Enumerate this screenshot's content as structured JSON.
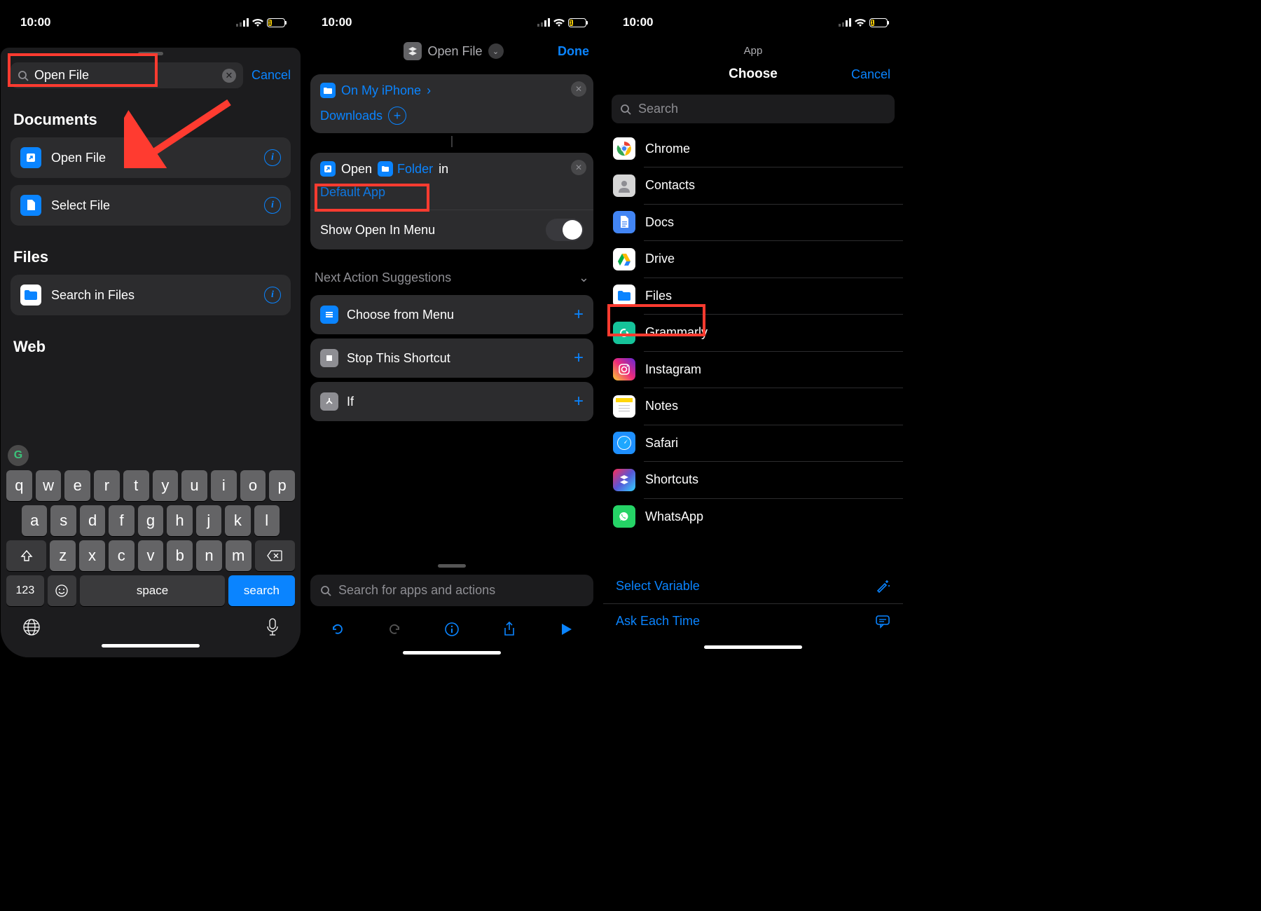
{
  "status": {
    "time": "10:00",
    "battery": "19"
  },
  "screen1": {
    "search_value": "Open File",
    "cancel": "Cancel",
    "sections": {
      "documents": "Documents",
      "files": "Files",
      "web": "Web"
    },
    "actions": {
      "open_file": "Open File",
      "select_file": "Select File",
      "search_in_files": "Search in Files"
    },
    "keyboard": {
      "row1": [
        "q",
        "w",
        "e",
        "r",
        "t",
        "y",
        "u",
        "i",
        "o",
        "p"
      ],
      "row2": [
        "a",
        "s",
        "d",
        "f",
        "g",
        "h",
        "j",
        "k",
        "l"
      ],
      "row3": [
        "z",
        "x",
        "c",
        "v",
        "b",
        "n",
        "m"
      ],
      "num": "123",
      "space": "space",
      "search": "search"
    }
  },
  "screen2": {
    "title": "Open File",
    "done": "Done",
    "path_root": "On My iPhone",
    "path_sub": "Downloads",
    "open_label": "Open",
    "folder_label": "Folder",
    "in_label": "in",
    "default_app": "Default App",
    "toggle_label": "Show Open In Menu",
    "nas_label": "Next Action Suggestions",
    "suggestions": {
      "choose": "Choose from Menu",
      "stop": "Stop This Shortcut",
      "if": "If"
    },
    "search_placeholder": "Search for apps and actions"
  },
  "screen3": {
    "header": "App",
    "choose": "Choose",
    "cancel": "Cancel",
    "search_placeholder": "Search",
    "apps": [
      "Chrome",
      "Contacts",
      "Docs",
      "Drive",
      "Files",
      "Grammarly",
      "Instagram",
      "Notes",
      "Safari",
      "Shortcuts",
      "WhatsApp"
    ],
    "select_variable": "Select Variable",
    "ask_each_time": "Ask Each Time"
  },
  "colors": {
    "accent": "#0a84ff",
    "highlight": "#ff3b30"
  }
}
